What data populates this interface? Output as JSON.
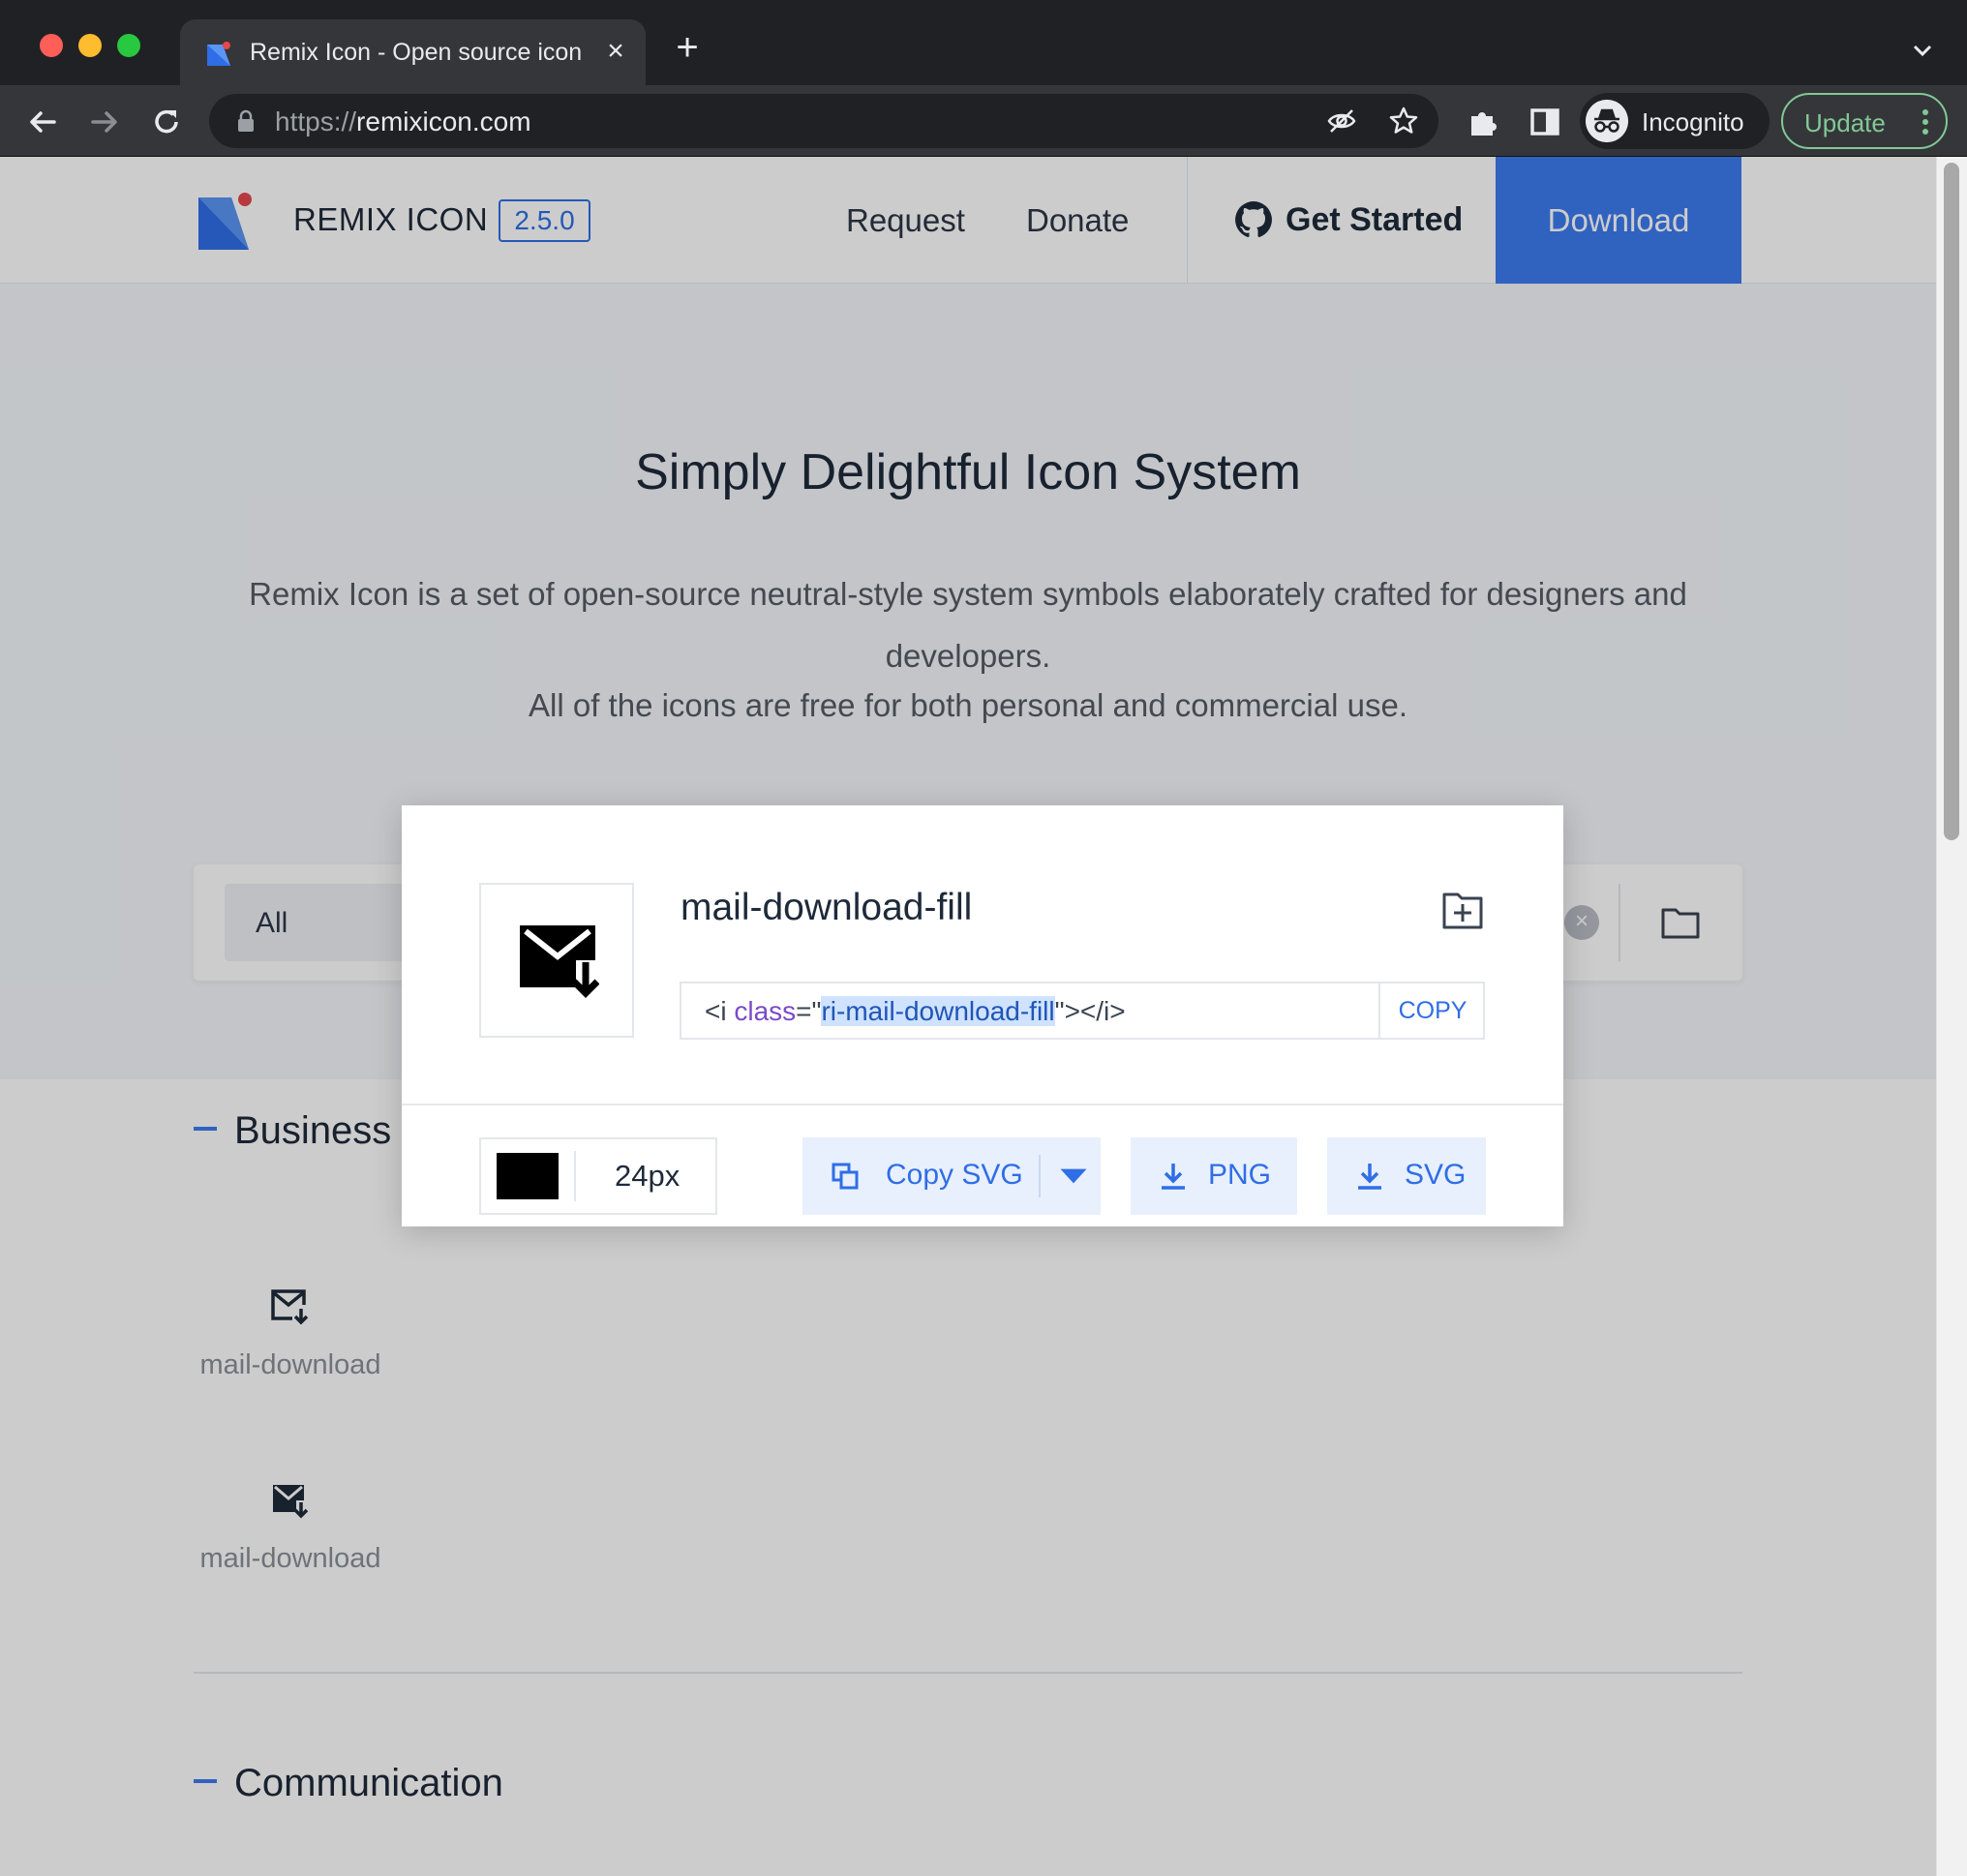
{
  "browser": {
    "tab_title": "Remix Icon - Open source icon",
    "new_tab_symbol": "+",
    "url_scheme": "https://",
    "url_host": "remixicon.com",
    "profile_label": "Incognito",
    "update_label": "Update"
  },
  "header": {
    "brand": "REMIX ICON",
    "version": "2.5.0",
    "nav": [
      "Request",
      "Donate"
    ],
    "get_started": "Get Started",
    "download": "Download"
  },
  "hero": {
    "title": "Simply Delightful Icon System",
    "description": "Remix Icon is a set of open-source neutral-style system symbols elaborately crafted for designers and developers.",
    "line2": "All of the icons are free for both personal and commercial use."
  },
  "search": {
    "category": "All",
    "clear_symbol": "×"
  },
  "sections": [
    {
      "title": "Business",
      "icons": [
        {
          "name": "mail-download",
          "icon": "mail-download-line-icon"
        },
        {
          "name": "mail-download",
          "icon": "mail-download-fill-icon"
        }
      ]
    },
    {
      "title": "Communication"
    }
  ],
  "modal": {
    "icon_name": "mail-download-fill",
    "code": {
      "prefix": "<i ",
      "attr": "class",
      "eq_quote": "=\"",
      "value": "ri-mail-download-fill",
      "suffix": "\"></i>"
    },
    "copy_label": "COPY",
    "color": "#000000",
    "size": "24px",
    "copy_svg_label": "Copy SVG",
    "png_label": "PNG",
    "svg_label": "SVG"
  },
  "colors": {
    "accent": "#3c7bf0",
    "chrome_bg": "#202124",
    "update_green": "#81c995"
  }
}
